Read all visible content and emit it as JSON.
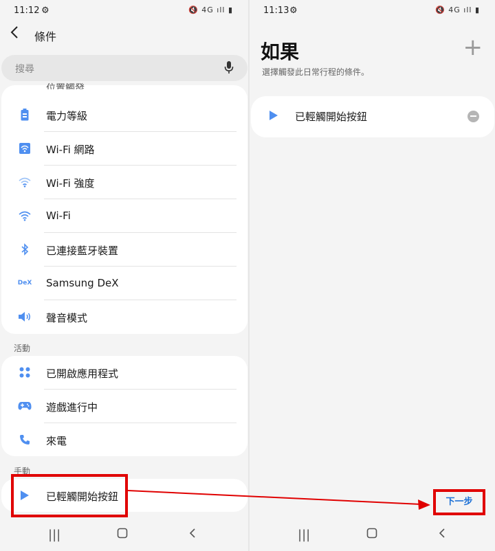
{
  "left": {
    "status": {
      "time": "11:12",
      "icons": "🔇 4G ıll ▮"
    },
    "header": {
      "title": "條件"
    },
    "search": {
      "placeholder": "搜尋"
    },
    "partial_item": "位置觸發",
    "items": [
      {
        "label": "電力等級",
        "icon": "battery-icon"
      },
      {
        "label": "Wi-Fi 網路",
        "icon": "wifi-network-icon"
      },
      {
        "label": "Wi-Fi 強度",
        "icon": "wifi-strength-icon"
      },
      {
        "label": "Wi-Fi",
        "icon": "wifi-icon"
      },
      {
        "label": "已連接藍牙裝置",
        "icon": "bluetooth-icon"
      },
      {
        "label": "Samsung DeX",
        "icon": "dex-icon"
      },
      {
        "label": "聲音模式",
        "icon": "volume-icon"
      }
    ],
    "sections": {
      "activity": "活動",
      "manual": "手動"
    },
    "activity_items": [
      {
        "label": "已開啟應用程式",
        "icon": "apps-icon"
      },
      {
        "label": "遊戲進行中",
        "icon": "gamepad-icon"
      },
      {
        "label": "來電",
        "icon": "phone-icon"
      }
    ],
    "manual_items": [
      {
        "label": "已輕觸開始按鈕",
        "icon": "play-icon"
      }
    ],
    "dex_text": "DeX"
  },
  "right": {
    "status": {
      "time": "11:13",
      "icons": "🔇 4G ıll ▮"
    },
    "title": "如果",
    "subtitle": "選擇觸發此日常行程的條件。",
    "condition": {
      "label": "已輕觸開始按鈕"
    },
    "next_label": "下一步"
  },
  "colors": {
    "accent": "#4f8ff0",
    "highlight": "#e00000",
    "link": "#1a6fd6"
  }
}
